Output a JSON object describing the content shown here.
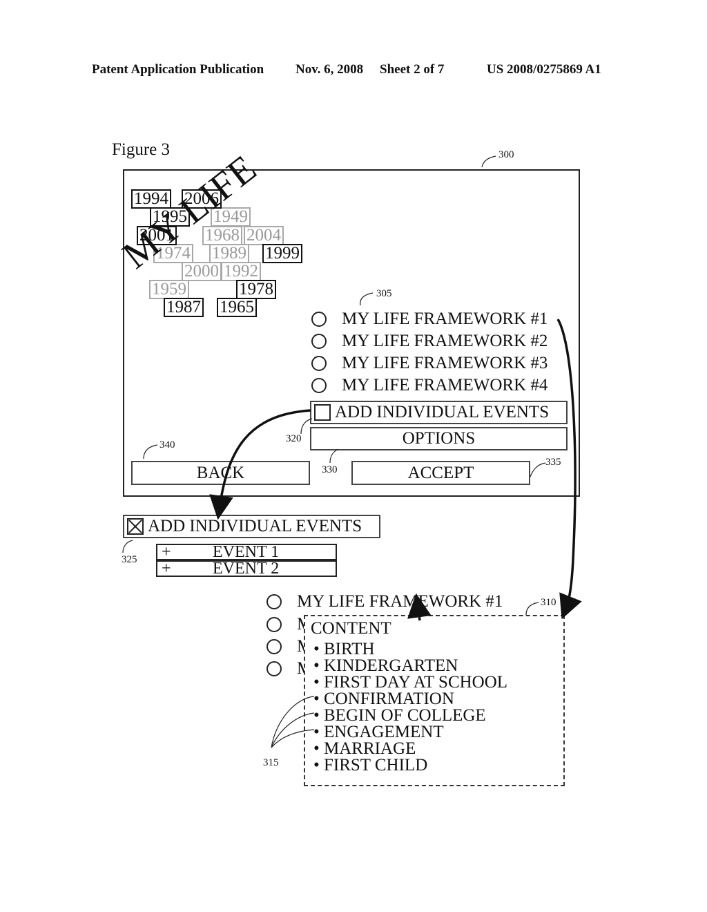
{
  "header": {
    "publication": "Patent Application Publication",
    "date": "Nov. 6, 2008",
    "sheet": "Sheet 2 of 7",
    "number": "US 2008/0275869 A1"
  },
  "figure": {
    "label": "Figure 3",
    "refs": {
      "screen": "300",
      "framework_list": "305",
      "content_popup": "310",
      "content_items": "315",
      "add_events_checkbox": "320",
      "event_list": "325",
      "options_button": "330",
      "accept_button": "335",
      "back_button": "340"
    }
  },
  "screen": {
    "collage_title": "MY LIFE",
    "years_bold": [
      "1994",
      "2006",
      "1995",
      "2001",
      "1999",
      "1978",
      "1987",
      "1965"
    ],
    "years_faded": [
      "1949",
      "1968",
      "2004",
      "1974",
      "1989",
      "2000",
      "1992",
      "1959"
    ],
    "frameworks": [
      {
        "label": "MY LIFE FRAMEWORK #1",
        "selected": false
      },
      {
        "label": "MY LIFE FRAMEWORK #2",
        "selected": false
      },
      {
        "label": "MY LIFE FRAMEWORK #3",
        "selected": false
      },
      {
        "label": "MY LIFE FRAMEWORK #4",
        "selected": false
      }
    ],
    "add_events": {
      "label": "ADD INDIVIDUAL EVENTS",
      "checked": false
    },
    "options_label": "OPTIONS",
    "back_label": "BACK",
    "accept_label": "ACCEPT"
  },
  "expanded_events": {
    "add_events": {
      "label": "ADD INDIVIDUAL EVENTS",
      "checked": true
    },
    "events": [
      {
        "icon": "+",
        "label": "EVENT 1"
      },
      {
        "icon": "+",
        "label": "EVENT 2"
      }
    ]
  },
  "framework_detail": {
    "frameworks": [
      {
        "label": "MY LIFE FRAMEWORK #1"
      },
      {
        "label": "M"
      },
      {
        "label": "M"
      },
      {
        "label": "M"
      }
    ],
    "content_title": "CONTENT",
    "content_items": [
      "• BIRTH",
      "• KINDERGARTEN",
      "• FIRST DAY AT SCHOOL",
      "• CONFIRMATION",
      "• BEGIN OF COLLEGE",
      "• ENGAGEMENT",
      "• MARRIAGE",
      "• FIRST CHILD"
    ]
  }
}
